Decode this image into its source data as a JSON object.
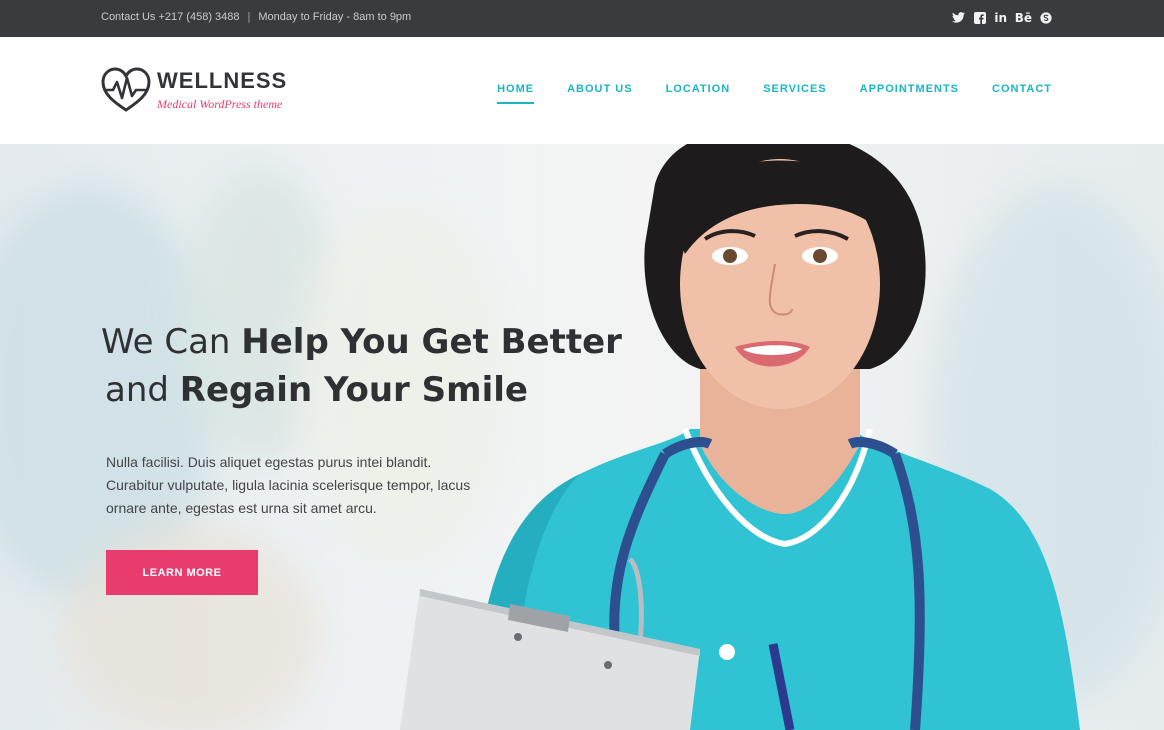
{
  "topbar": {
    "contact": "Contact Us +217 (458) 3488",
    "separator": "|",
    "hours": "Monday to Friday - 8am to 9pm",
    "social": [
      {
        "icon": "twitter-icon"
      },
      {
        "icon": "facebook-icon"
      },
      {
        "icon": "linkedin-icon",
        "glyph": "in"
      },
      {
        "icon": "behance-icon",
        "glyph": "Bē"
      },
      {
        "icon": "skype-icon"
      }
    ]
  },
  "logo": {
    "title": "WELLNESS",
    "tagline": "Medical WordPress theme"
  },
  "nav": {
    "items": [
      {
        "label": "HOME",
        "active": true
      },
      {
        "label": "ABOUT US"
      },
      {
        "label": "LOCATION"
      },
      {
        "label": "SERVICES"
      },
      {
        "label": "APPOINTMENTS"
      },
      {
        "label": "CONTACT"
      }
    ]
  },
  "hero": {
    "heading_line1_light": "We Can ",
    "heading_line1_bold": "Help You Get Better",
    "heading_line2_light": "and ",
    "heading_line2_bold": "Regain Your Smile",
    "text": "Nulla facilisi. Duis aliquet egestas purus intei blandit. Curabitur vulputate, ligula lacinia scelerisque tempor, lacus ornare ante, egestas est urna sit amet arcu.",
    "cta": "LEARN MORE"
  },
  "colors": {
    "accent": "#19b5c6",
    "brand_pink": "#e73c6d",
    "topbar": "#3a3b3f",
    "scrubs": "#2fc3d3"
  }
}
